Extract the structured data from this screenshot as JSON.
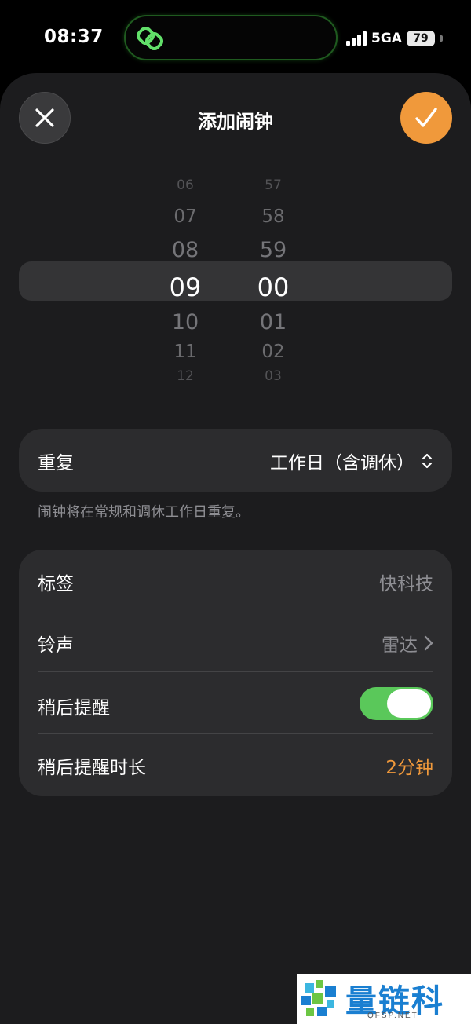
{
  "status_bar": {
    "time": "08:37",
    "network": "5GA",
    "battery": "79"
  },
  "sheet": {
    "title": "添加闹钟"
  },
  "picker": {
    "hours": [
      "06",
      "07",
      "08",
      "09",
      "10",
      "11",
      "12"
    ],
    "minutes": [
      "57",
      "58",
      "59",
      "00",
      "01",
      "02",
      "03"
    ],
    "selected_index": 3
  },
  "repeat": {
    "label": "重复",
    "value": "工作日（含调休）",
    "footnote": "闹钟将在常规和调休工作日重复。"
  },
  "options": {
    "label_row": {
      "label": "标签",
      "value": "快科技"
    },
    "sound_row": {
      "label": "铃声",
      "value": "雷达"
    },
    "snooze_row": {
      "label": "稍后提醒",
      "enabled": true
    },
    "snooze_duration_row": {
      "label": "稍后提醒时长",
      "value": "2分钟"
    }
  },
  "watermark": {
    "title": "量链科技",
    "subtitle": "QFSP.NET"
  },
  "colors": {
    "accent": "#f0993b",
    "toggle_on": "#5ac85a",
    "sheet_bg": "#1c1c1e",
    "card_bg": "#2c2c2e"
  }
}
